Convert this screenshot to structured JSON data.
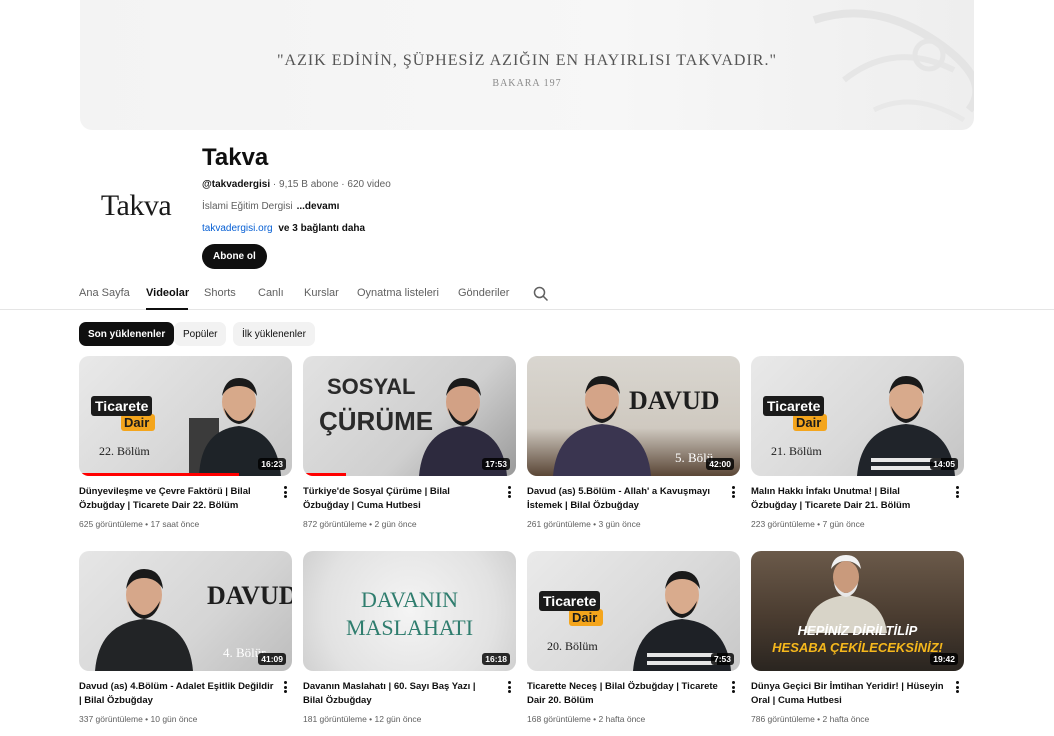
{
  "banner": {
    "quote": "\"AZIK EDİNİN, ŞÜPHESİZ AZIĞIN EN HAYIRLISI TAKVADIR.\"",
    "source": "BAKARA 197"
  },
  "channel": {
    "avatar_text": "Takva",
    "name": "Takva",
    "handle": "@takvadergisi",
    "stats": " · 9,15 B abone · 620 video",
    "description": "İslami Eğitim Dergisi",
    "description_more": "...devamı",
    "link": "takvadergisi.org",
    "more_links": "ve 3 bağlantı daha",
    "subscribe_label": "Abone ol"
  },
  "tabs": [
    {
      "label": "Ana Sayfa"
    },
    {
      "label": "Videolar"
    },
    {
      "label": "Shorts"
    },
    {
      "label": "Canlı"
    },
    {
      "label": "Kurslar"
    },
    {
      "label": "Oynatma listeleri"
    },
    {
      "label": "Gönderiler"
    }
  ],
  "active_tab": "Videolar",
  "chips": [
    {
      "label": "Son yüklenenler"
    },
    {
      "label": "Popüler"
    },
    {
      "label": "İlk yüklenenler"
    }
  ],
  "thumb_text": {
    "ticaret": "Ticarete",
    "dair": "Dair",
    "sosyal": "SOSYAL",
    "curume": "ÇÜRÜME",
    "davud": "DAVUD",
    "davanin": "DAVANIN",
    "maslahati": "MASLAHATI",
    "hepiniz": "HEPİNİZ DİRİLTİLİP",
    "hesaba": "HESABA ÇEKİLECEKSİNİZ!",
    "ep22": "22. Bölüm",
    "ep21": "21. Bölüm",
    "ep20": "20. Bölüm",
    "ep5": "5. Bölü",
    "ep4": "4. Bölür"
  },
  "videos": [
    {
      "title": "Dünyevileşme ve Çevre Faktörü | Bilal Özbuğday | Ticarete Dair 22. Bölüm",
      "views": "625 görüntüleme",
      "age": "17 saat önce",
      "duration": "16:23",
      "progress": 0.75
    },
    {
      "title": "Türkiye'de Sosyal Çürüme | Bilal Özbuğday | Cuma Hutbesi",
      "views": "872 görüntüleme",
      "age": "2 gün önce",
      "duration": "17:53",
      "progress": 0.2
    },
    {
      "title": "Davud (as) 5.Bölüm - Allah' a Kavuşmayı İstemek | Bilal Özbuğday",
      "views": "261 görüntüleme",
      "age": "3 gün önce",
      "duration": "42:00",
      "progress": 0
    },
    {
      "title": "Malın Hakkı İnfakı Unutma! | Bilal Özbuğday | Ticarete Dair 21. Bölüm",
      "views": "223 görüntüleme",
      "age": "7 gün önce",
      "duration": "14:05",
      "progress": 0
    },
    {
      "title": "Davud (as) 4.Bölüm - Adalet Eşitlik Değildir | Bilal Özbuğday",
      "views": "337 görüntüleme",
      "age": "10 gün önce",
      "duration": "41:09",
      "progress": 0
    },
    {
      "title": "Davanın Maslahatı | 60. Sayı Baş Yazı | Bilal Özbuğday",
      "views": "181 görüntüleme",
      "age": "12 gün önce",
      "duration": "16:18",
      "progress": 0
    },
    {
      "title": "Ticarette Neceş | Bilal Özbuğday | Ticarete Dair 20. Bölüm",
      "views": "168 görüntüleme",
      "age": "2 hafta önce",
      "duration": "7:53",
      "progress": 0
    },
    {
      "title": "Dünya Geçici Bir İmtihan Yeridir! | Hüseyin Oral | Cuma Hutbesi",
      "views": "786 görüntüleme",
      "age": "2 hafta önce",
      "duration": "19:42",
      "progress": 0
    }
  ]
}
